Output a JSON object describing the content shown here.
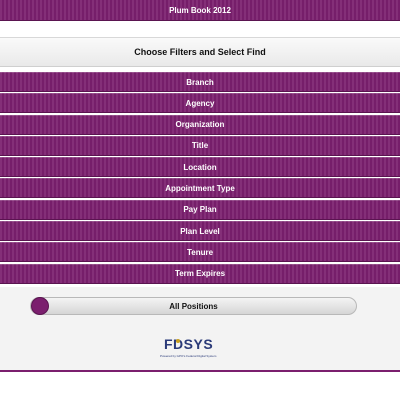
{
  "app": {
    "title": "Plum Book 2012"
  },
  "filters": {
    "header": "Choose Filters and Select Find"
  },
  "menu": {
    "items": [
      {
        "label": "Branch"
      },
      {
        "label": "Agency"
      },
      {
        "label": "Organization"
      },
      {
        "label": "Title"
      },
      {
        "label": "Location"
      },
      {
        "label": "Appointment Type"
      },
      {
        "label": "Pay Plan"
      },
      {
        "label": "Plan Level"
      },
      {
        "label": "Tenure"
      },
      {
        "label": "Term Expires"
      }
    ]
  },
  "toggle": {
    "label": "All Positions"
  },
  "logo": {
    "name": "FDSYS",
    "tagline": "Powered by GPO's Federal Digital System"
  },
  "colors": {
    "accent": "#7b1f6e",
    "logo": "#2a3a78"
  }
}
